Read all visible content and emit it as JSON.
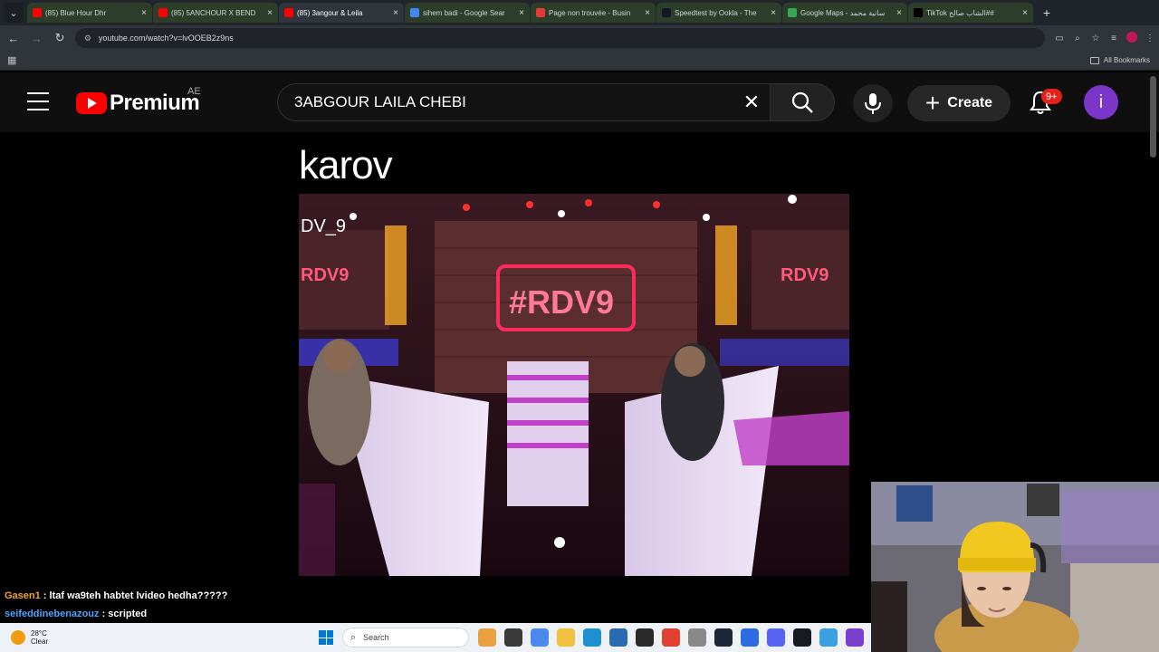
{
  "browser": {
    "tabs": [
      {
        "title": "(85) Blue Hour Dhr",
        "favicon_color": "#ff0000",
        "active": false
      },
      {
        "title": "(85) 5ANCHOUR X BEND",
        "favicon_color": "#ff0000",
        "active": false
      },
      {
        "title": "(85) 3angour & Leila",
        "favicon_color": "#ff0000",
        "active": true
      },
      {
        "title": "sihem badi - Google Sear",
        "favicon_color": "#4285f4",
        "active": false
      },
      {
        "title": "Page non trouvée - Busin",
        "favicon_color": "#e53935",
        "active": false
      },
      {
        "title": "Speedtest by Ookla - The",
        "favicon_color": "#141526",
        "active": false
      },
      {
        "title": "Google Maps - سانية محمد",
        "favicon_color": "#34a853",
        "active": false
      },
      {
        "title": "TikTok الشاب صالح##",
        "favicon_color": "#000000",
        "active": false
      }
    ],
    "url": "youtube.com/watch?v=lvOOEB2z9ns",
    "bookmarks_label": "All Bookmarks"
  },
  "youtube": {
    "logo_text": "Premium",
    "country_code": "AE",
    "search_value": "3ABGOUR LAILA CHEBI",
    "create_label": "Create",
    "notification_badge": "9+",
    "avatar_letter": "i"
  },
  "video": {
    "caption_text": "karov"
  },
  "chat": [
    {
      "user": "Gasen1",
      "message": " : ltaf wa9teh habtet lvideo hedha?????"
    },
    {
      "user": "seifeddinebenazouz",
      "message": " : scripted"
    }
  ],
  "taskbar": {
    "temperature": "28°C",
    "weather": "Clear",
    "search_placeholder": "Search"
  }
}
